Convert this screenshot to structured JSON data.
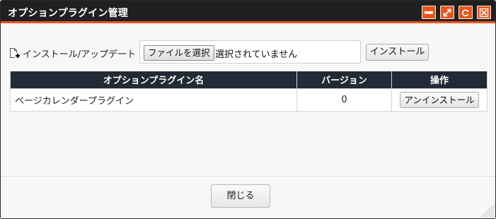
{
  "window": {
    "title": "オプションプラグイン管理",
    "controls": [
      {
        "name": "minimize-icon"
      },
      {
        "name": "maximize-icon"
      },
      {
        "name": "refresh-icon"
      },
      {
        "name": "close-icon"
      }
    ],
    "accent_color": "#e8561c",
    "titlebar_color": "#202020"
  },
  "install": {
    "label": "インストール/アップデート",
    "icon": "document-add-icon",
    "choose_file_label": "ファイルを選択",
    "file_status": "選択されていません",
    "install_button": "インストール"
  },
  "table": {
    "header_color": "#222a35",
    "columns": [
      "オプションプラグイン名",
      "バージョン",
      "操作"
    ],
    "rows": [
      {
        "name": "ページカレンダープラグイン",
        "version": "0",
        "action": "アンインストール"
      }
    ]
  },
  "footer": {
    "close_button": "閉じる"
  }
}
